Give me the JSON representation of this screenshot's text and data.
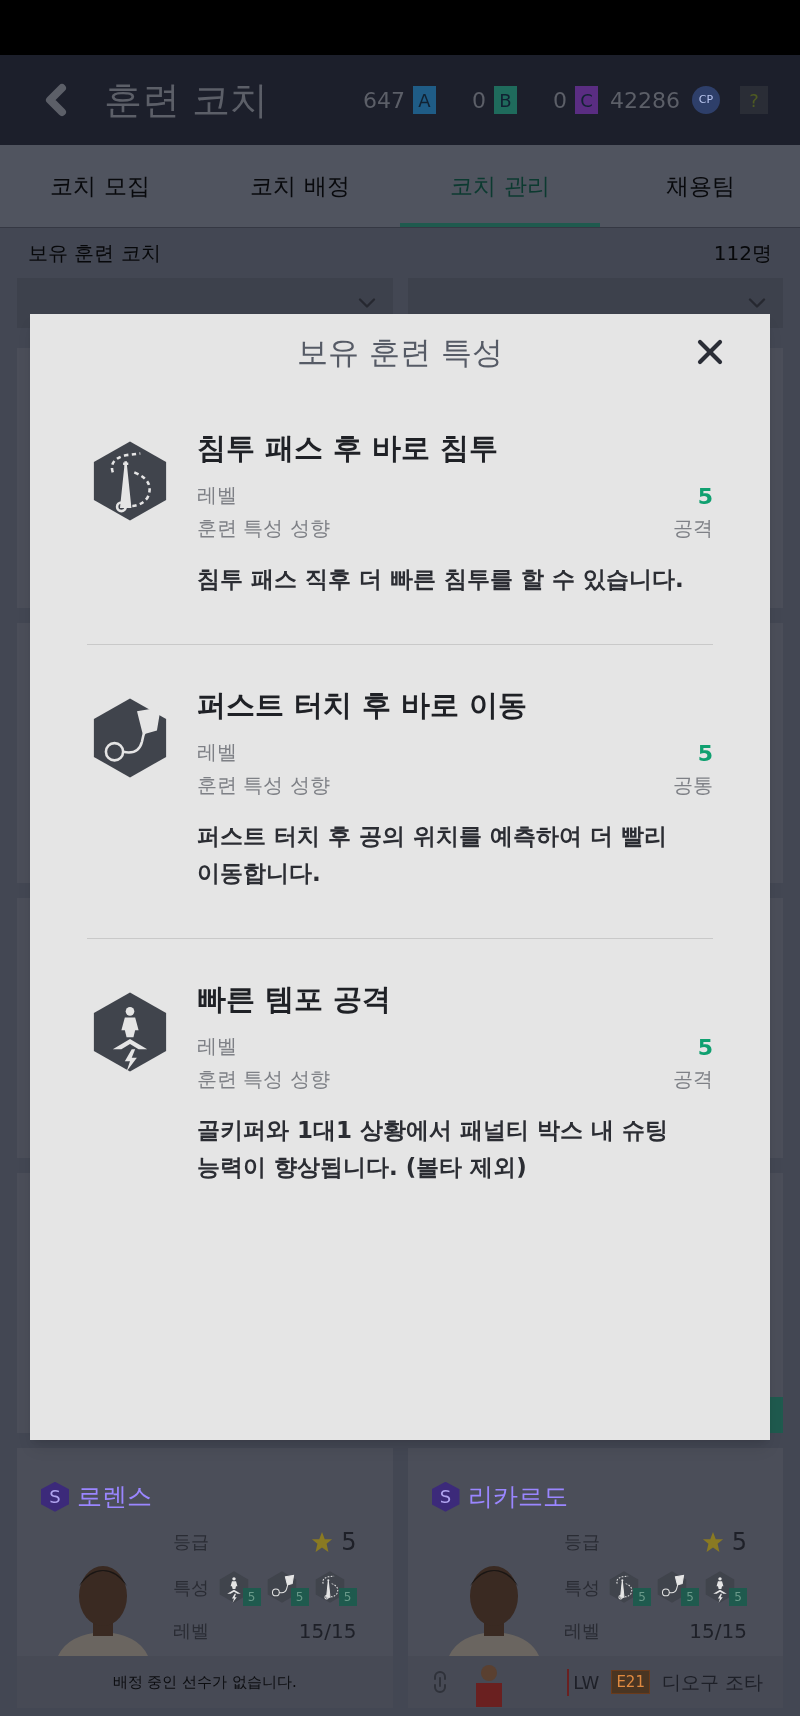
{
  "header": {
    "title": "훈련 코치",
    "currencies": [
      {
        "amount": "647",
        "label": "A",
        "color": "#1f5c86"
      },
      {
        "amount": "0",
        "label": "B",
        "color": "#1f6b5c"
      },
      {
        "amount": "0",
        "label": "C",
        "color": "#5a2d82"
      }
    ],
    "cp": {
      "amount": "42286",
      "label": "CP"
    },
    "help": "?"
  },
  "tabs": [
    {
      "label": "코치 모집",
      "selected": false
    },
    {
      "label": "코치 배정",
      "selected": false
    },
    {
      "label": "코치 관리",
      "selected": true
    },
    {
      "label": "채용팀",
      "selected": false
    }
  ],
  "summary": {
    "label": "보유 훈련 코치",
    "count": "112명"
  },
  "dialog": {
    "title": "보유 훈련 특성",
    "traits": [
      {
        "kind": "pass",
        "title": "침투 패스 후 바로 침투",
        "level_label": "레벨",
        "level": "5",
        "type_label": "훈련 특성 성향",
        "type": "공격",
        "description": "침투 패스 직후 더 빠른 침투를 할 수 있습니다."
      },
      {
        "kind": "touch",
        "title": "퍼스트 터치 후 바로 이동",
        "level_label": "레벨",
        "level": "5",
        "type_label": "훈련 특성 성향",
        "type": "공통",
        "description": "퍼스트 터치 후 공의 위치를 예측하여 더 빨리 이동합니다."
      },
      {
        "kind": "tempo",
        "title": "빠른 템포 공격",
        "level_label": "레벨",
        "level": "5",
        "type_label": "훈련 특성 성향",
        "type": "공격",
        "description": "골키퍼와 1대1 상황에서 패널티 박스 내 슈팅 능력이 향상됩니다. (볼타 제외)"
      }
    ]
  },
  "coaches": [
    {
      "rank": "S",
      "name": "로렌스",
      "grade_label": "등급",
      "grade": "5",
      "trait_label": "특성",
      "traits": [
        {
          "kind": "tempo",
          "level": "5"
        },
        {
          "kind": "touch",
          "level": "5"
        },
        {
          "kind": "pass",
          "level": "5"
        }
      ],
      "level_label": "레벨",
      "level": "15/15",
      "footer": {
        "kind": "empty",
        "text": "배정 중인 선수가 없습니다."
      }
    },
    {
      "rank": "S",
      "name": "리카르도",
      "grade_label": "등급",
      "grade": "5",
      "trait_label": "특성",
      "traits": [
        {
          "kind": "pass",
          "level": "5"
        },
        {
          "kind": "touch",
          "level": "5"
        },
        {
          "kind": "tempo",
          "level": "5"
        }
      ],
      "level_label": "레벨",
      "level": "15/15",
      "footer": {
        "kind": "player",
        "position": "LW",
        "season": "E21",
        "name": "디오구 조타"
      }
    }
  ]
}
